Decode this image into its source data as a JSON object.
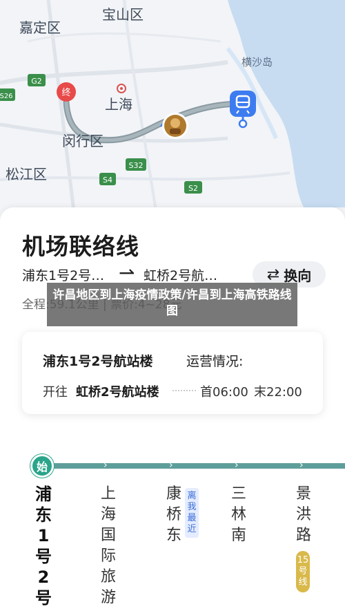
{
  "map": {
    "districts": {
      "baoshan": "宝山区",
      "jiading": "嘉定区",
      "shanghai": "上海",
      "minhang": "闵行区",
      "songjiang": "松江区",
      "hengsha": "横沙岛"
    },
    "highway_shields": [
      "G2",
      "S26",
      "S32",
      "S4",
      "S2"
    ],
    "line_badge": "机场联络线"
  },
  "sheet": {
    "title": "机场联络线",
    "route_from": "浦东1号2号…",
    "route_to": "虹桥2号航…",
    "switch_label": "换向",
    "meta": "全程:59.1公里 | 票价:4~28元"
  },
  "banner": {
    "text": "许昌地区到上海疫情政策/许昌到上海高铁路线图"
  },
  "card": {
    "station": "浦东1号2号航站楼",
    "status_label": "运营情况:",
    "direction_label": "开往",
    "direction_value": "虹桥2号航站楼",
    "first_train": "首06:00",
    "last_train": "末22:00"
  },
  "line": {
    "start_badge": "始",
    "color": "#5e9e9a",
    "stations": [
      "浦东1号2号",
      "上海国际旅游",
      "康桥东",
      "三林南",
      "景洪路"
    ],
    "near_tag": "离我最近",
    "transfer_tag": "15号线"
  }
}
